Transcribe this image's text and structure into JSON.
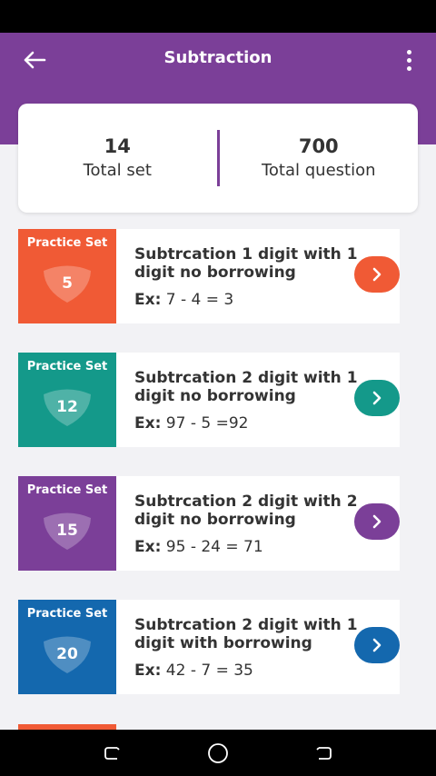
{
  "header": {
    "title": "Subtraction",
    "color": "#7b3f98",
    "back_icon": "arrow-left-icon",
    "menu_icon": "more-vertical-icon"
  },
  "summary": {
    "total_set_value": "14",
    "total_set_label": "Total set",
    "total_question_value": "700",
    "total_question_label": "Total question"
  },
  "sets": [
    {
      "badge_label": "Practice Set",
      "number": "5",
      "title": "Subtrcation 1 digit with 1 digit no borrowing",
      "example_prefix": "Ex:",
      "example": "7 - 4 = 3",
      "color": "#f05a35"
    },
    {
      "badge_label": "Practice Set",
      "number": "12",
      "title": "Subtrcation 2 digit with 1 digit no borrowing",
      "example_prefix": "Ex:",
      "example": "97 - 5 =92",
      "color": "#14998a"
    },
    {
      "badge_label": "Practice Set",
      "number": "15",
      "title": "Subtrcation 2 digit with 2 digit no borrowing",
      "example_prefix": "Ex:",
      "example": "95 - 24 = 71",
      "color": "#7b3f98"
    },
    {
      "badge_label": "Practice Set",
      "number": "20",
      "title": "Subtrcation 2 digit with 1 digit with borrowing",
      "example_prefix": "Ex:",
      "example": "42 - 7 = 35",
      "color": "#1468ae"
    }
  ],
  "nav": {
    "recents_icon": "recent-apps-icon",
    "home_icon": "home-circle-icon",
    "back_icon": "system-back-icon"
  }
}
